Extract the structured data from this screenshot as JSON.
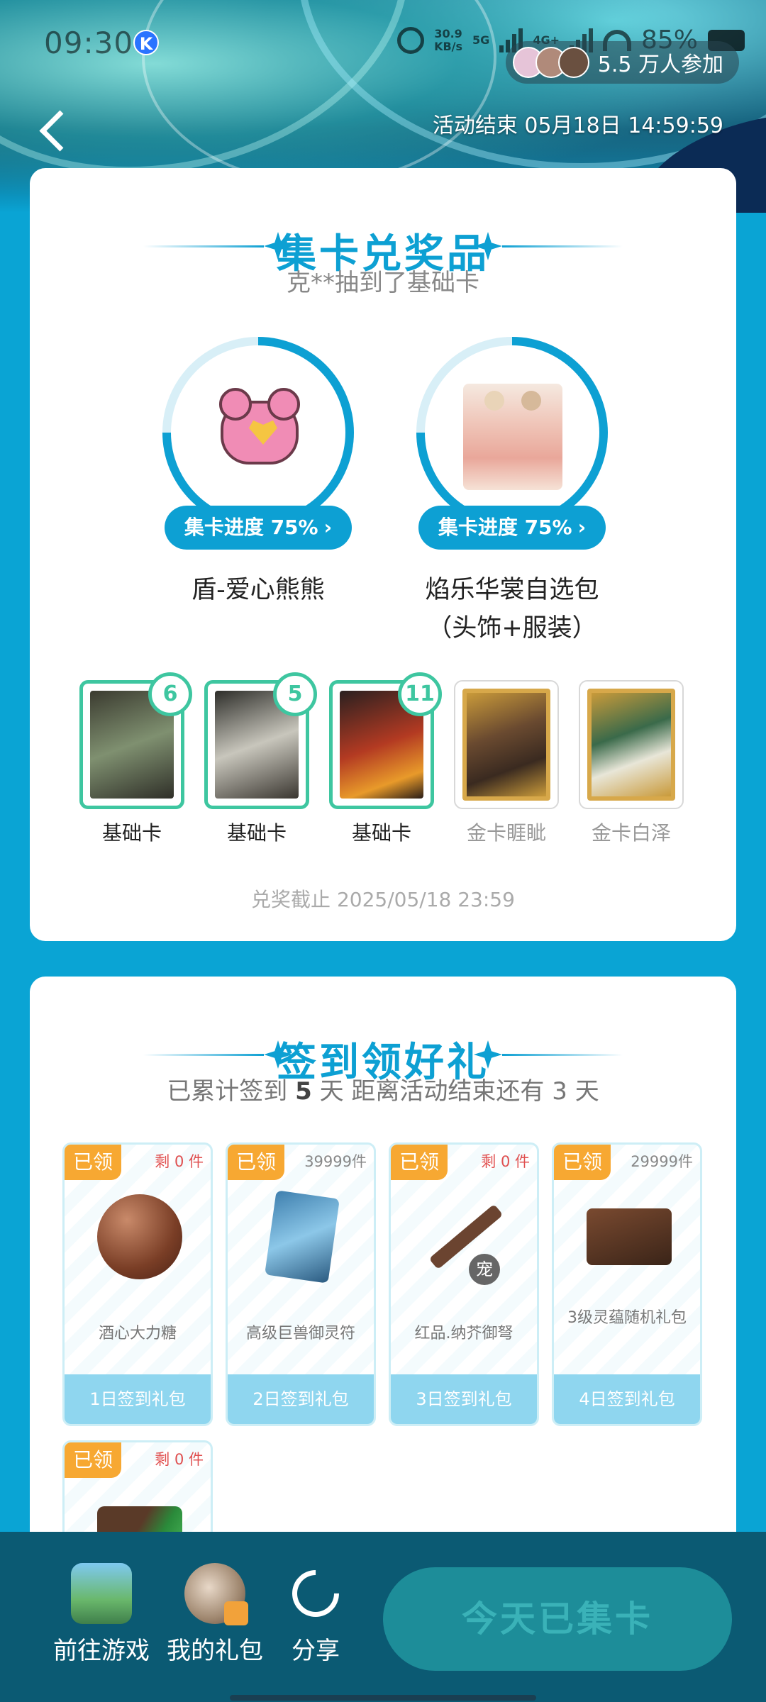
{
  "status_bar": {
    "time": "09:30",
    "app_badge": "K",
    "net_speed_value": "30.9",
    "net_speed_unit": "KB/s",
    "network_1": "5G",
    "network_2": "4G+",
    "battery": "85%"
  },
  "header": {
    "participants": "5.5 万人参加",
    "event_end": "活动结束 05月18日 14:59:59"
  },
  "collect_section": {
    "title": "集卡兑奖品",
    "broadcast": "克**抽到了基础卡",
    "prizes": [
      {
        "progress_label": "集卡进度 75%",
        "progress": 0.75,
        "name": "盾-爱心熊熊",
        "name_line2": ""
      },
      {
        "progress_label": "集卡进度 75%",
        "progress": 0.75,
        "name": "焰乐华裳自选包",
        "name_line2": "（头饰+服装）"
      }
    ],
    "cards": [
      {
        "label": "基础卡",
        "count": "6",
        "owned": true
      },
      {
        "label": "基础卡",
        "count": "5",
        "owned": true
      },
      {
        "label": "基础卡",
        "count": "11",
        "owned": true
      },
      {
        "label": "金卡睚眦",
        "count": "",
        "owned": false
      },
      {
        "label": "金卡白泽",
        "count": "",
        "owned": false
      }
    ],
    "deadline": "兑奖截止 2025/05/18 23:59"
  },
  "signin_section": {
    "title": "签到领好礼",
    "summary_prefix": "已累计签到",
    "summary_days": "5",
    "summary_mid": "天  距离活动结束还有",
    "summary_remaining": "3",
    "summary_suffix": "天",
    "gifts": [
      {
        "claimed": "已领",
        "stock": "剩 0 件",
        "name": "酒心大力糖",
        "day": "1日签到礼包"
      },
      {
        "claimed": "已领",
        "stock": "39999件",
        "name": "高级巨兽御灵符",
        "day": "2日签到礼包"
      },
      {
        "claimed": "已领",
        "stock": "剩 0 件",
        "name": "红品.纳芥御弩",
        "day": "3日签到礼包",
        "tag": "宠"
      },
      {
        "claimed": "已领",
        "stock": "29999件",
        "name": "3级灵蕴随机礼包",
        "day": "4日签到礼包"
      },
      {
        "claimed": "已领",
        "stock": "剩 0 件",
        "name": "",
        "day": ""
      }
    ]
  },
  "bottom_bar": {
    "go_game": "前往游戏",
    "my_gifts": "我的礼包",
    "share": "分享",
    "collect_button": "今天已集卡"
  },
  "colors": {
    "accent": "#0da0d3",
    "owned_card": "#3ec6a0",
    "claimed_badge": "#f7a832",
    "bottom_bar": "#0b5a73"
  }
}
